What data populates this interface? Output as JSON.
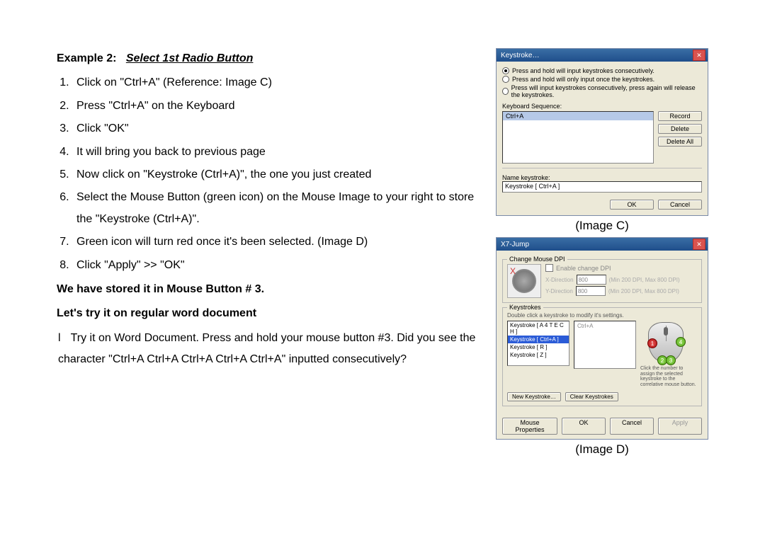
{
  "heading": {
    "prefix": "Example 2:",
    "title": "Select 1st Radio Button"
  },
  "steps": [
    "Click on \"Ctrl+A\" (Reference:    Image C)",
    "Press \"Ctrl+A\" on the Keyboard",
    "Click \"OK\"",
    "It will bring you back to previous page",
    "Now click on \"Keystroke (Ctrl+A)\", the one you just created",
    "Select the Mouse Button (green icon) on the Mouse Image to your right to store the \"Keystroke (Ctrl+A)\".",
    "Green icon will turn red once it's been selected. (Image D)",
    "Click \"Apply\" >> \"OK\""
  ],
  "subheading1": "We have stored it in Mouse Button # 3.",
  "subheading2": "Let's try it on regular word document",
  "bullets": [
    "Try it on Word Document.    Press and hold your mouse button #3.    Did you see the character \"Ctrl+A Ctrl+A Ctrl+A Ctrl+A Ctrl+A\" inputted consecutively?"
  ],
  "captions": {
    "c": "(Image C)",
    "d": "(Image D)"
  },
  "imageC": {
    "title": "Keystroke…",
    "radios": [
      "Press and hold will input keystrokes consecutively.",
      "Press and hold will only input once the keystrokes.",
      "Press will input keystrokes consecutively, press again will release the keystrokes."
    ],
    "seqLabel": "Keyboard Sequence:",
    "seqItem": "Ctrl+A",
    "btnRecord": "Record",
    "btnDelete": "Delete",
    "btnDeleteAll": "Delete All",
    "nameLabel": "Name keystroke:",
    "nameValue": "Keystroke [ Ctrl+A ]",
    "ok": "OK",
    "cancel": "Cancel"
  },
  "imageD": {
    "title": "X7-Jump",
    "grpDpi": "Change Mouse DPI",
    "enableDpi": "Enable change DPI",
    "xdir": "X-Direction",
    "ydir": "Y-Direction",
    "dpiVal": "800",
    "dpiHint": "(Min 200 DPI, Max 800 DPI)",
    "grpKs": "Keystrokes",
    "note1": "Double click a keystroke to modify it's settings.",
    "list": [
      "Keystroke [ A 4 T E C H ]",
      "Keystroke [ Ctrl+A ]",
      "Keystroke [ R ]",
      "Keystroke [ Z ]"
    ],
    "preview": "Ctrl+A",
    "newKs": "New Keystroke…",
    "clearKs": "Clear Keystrokes",
    "mouseHint": "Click the number to assign the selected keystroke to the correlative mouse button.",
    "mouseProps": "Mouse Properties",
    "ok": "OK",
    "cancel": "Cancel",
    "apply": "Apply"
  }
}
